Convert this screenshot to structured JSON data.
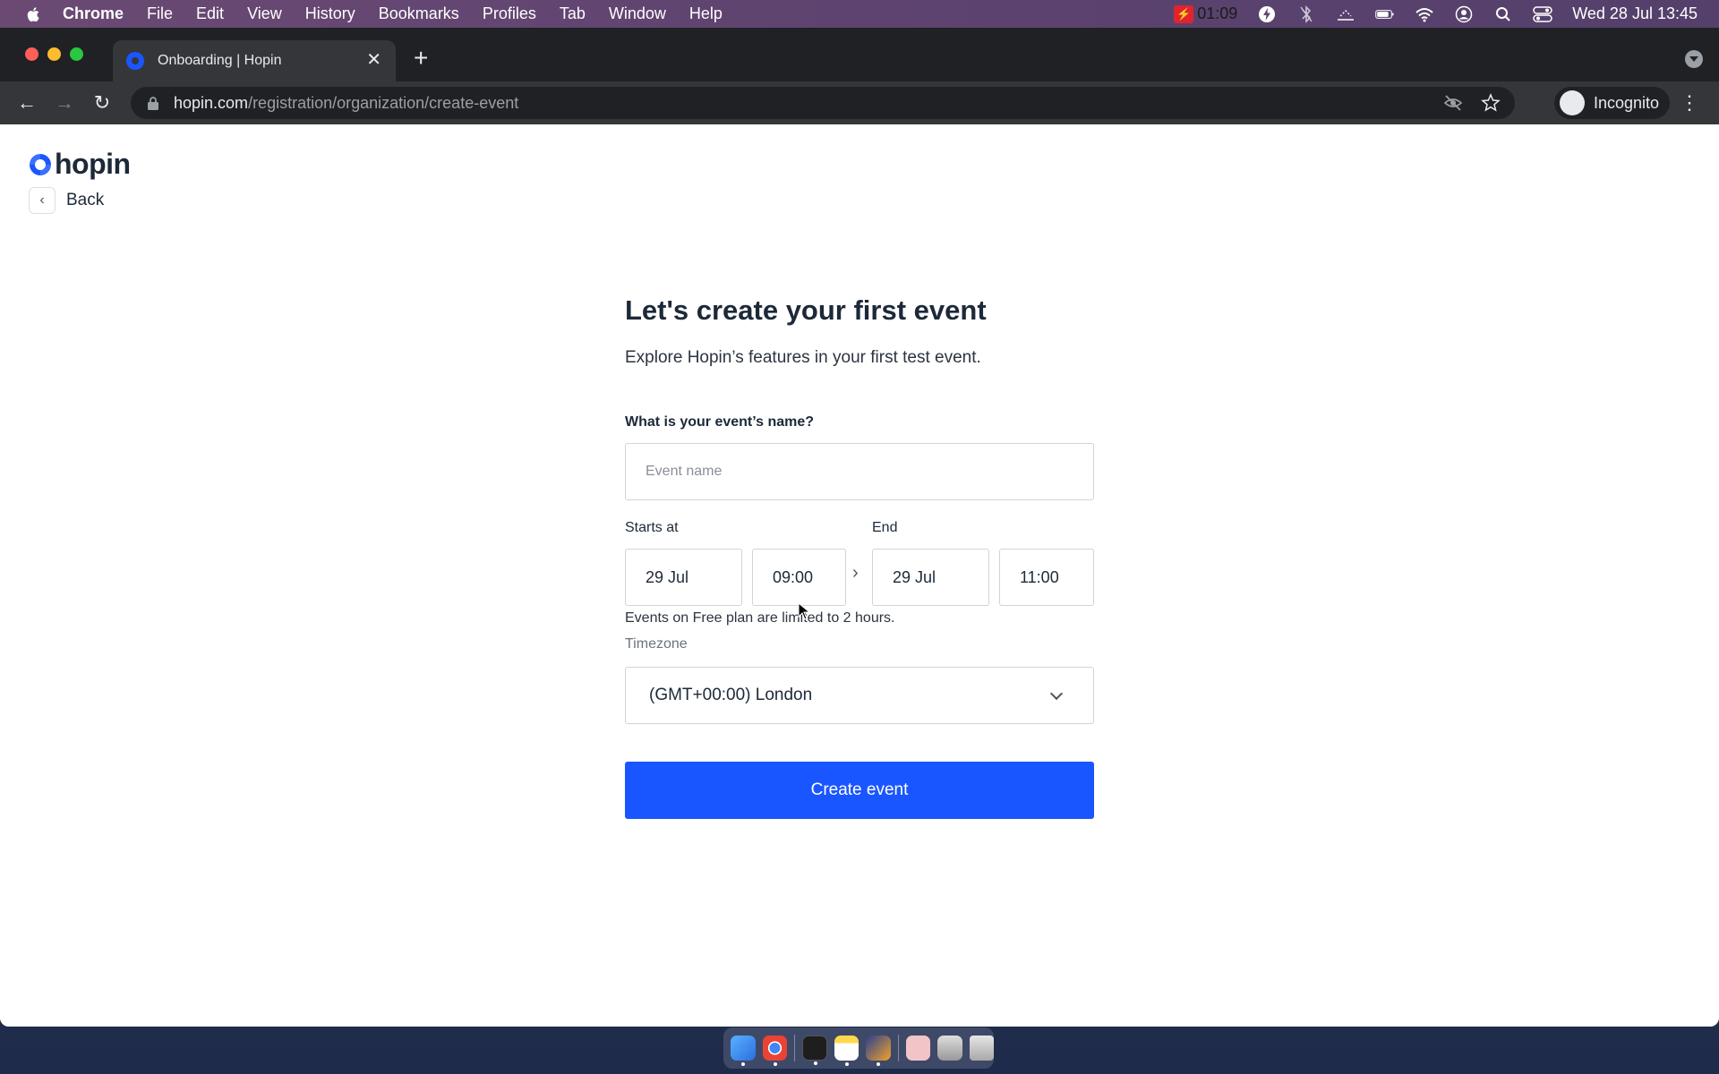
{
  "menubar": {
    "app": "Chrome",
    "items": [
      "File",
      "Edit",
      "View",
      "History",
      "Bookmarks",
      "Profiles",
      "Tab",
      "Window",
      "Help"
    ],
    "timer": "01:09",
    "datetime": "Wed 28 Jul  13:45"
  },
  "browser": {
    "tab_title": "Onboarding | Hopin",
    "url_host": "hopin.com",
    "url_path": "/registration/organization/create-event",
    "profile_label": "Incognito"
  },
  "page": {
    "logo_text": "hopin",
    "back_label": "Back",
    "title": "Let's create your first event",
    "subtitle": "Explore Hopin’s features in your first test event.",
    "name_question": "What is your event’s name?",
    "name_placeholder": "Event name",
    "starts_label": "Starts at",
    "end_label": "End",
    "start_date": "29 Jul",
    "start_time": "09:00",
    "end_date": "29 Jul",
    "end_time": "11:00",
    "limit_note": "Events on Free plan are limited to 2 hours.",
    "timezone_label": "Timezone",
    "timezone_value": "(GMT+00:00) London",
    "submit_label": "Create event"
  },
  "colors": {
    "accent": "#1a56ff",
    "heading": "#1d2939"
  }
}
